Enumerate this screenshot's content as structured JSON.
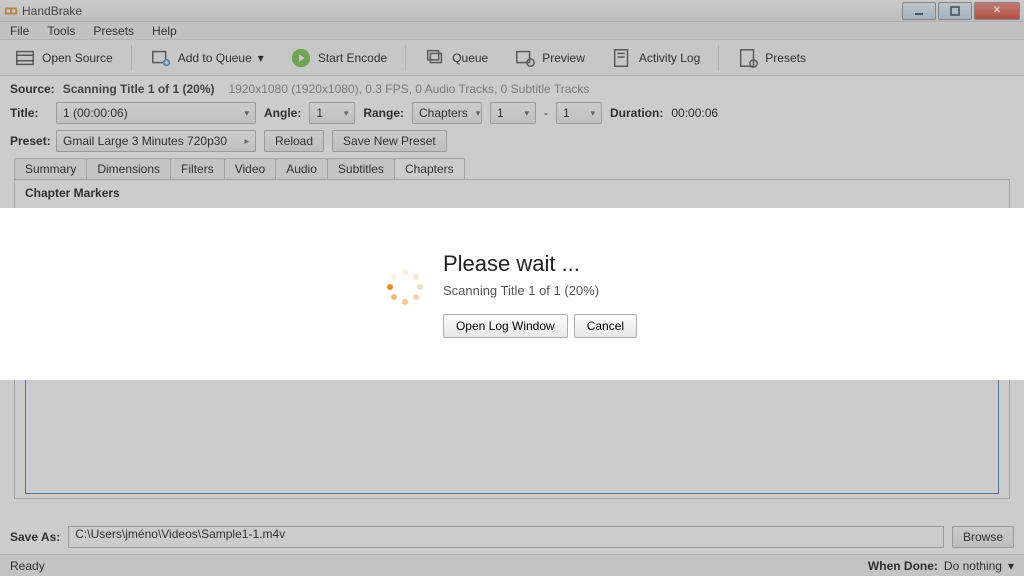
{
  "window": {
    "title": "HandBrake"
  },
  "menu": {
    "file": "File",
    "tools": "Tools",
    "presets": "Presets",
    "help": "Help"
  },
  "toolbar": {
    "open_source": "Open Source",
    "add_to_queue": "Add to Queue",
    "start_encode": "Start Encode",
    "queue": "Queue",
    "preview": "Preview",
    "activity_log": "Activity Log",
    "presets": "Presets"
  },
  "source": {
    "label": "Source:",
    "scan_text": "Scanning Title 1 of 1 (20%)",
    "info": "1920x1080 (1920x1080), 0.3 FPS, 0 Audio Tracks, 0 Subtitle Tracks"
  },
  "title_row": {
    "title_label": "Title:",
    "title_value": "1  (00:00:06)",
    "angle_label": "Angle:",
    "angle_value": "1",
    "range_label": "Range:",
    "range_mode": "Chapters",
    "range_from": "1",
    "range_dash": "-",
    "range_to": "1",
    "duration_label": "Duration:",
    "duration_value": "00:00:06"
  },
  "preset_row": {
    "label": "Preset:",
    "value": "Gmail Large 3 Minutes 720p30",
    "reload": "Reload",
    "save_new": "Save New Preset"
  },
  "tabs": {
    "summary": "Summary",
    "dimensions": "Dimensions",
    "filters": "Filters",
    "video": "Video",
    "audio": "Audio",
    "subtitles": "Subtitles",
    "chapters": "Chapters"
  },
  "chapters_pane": {
    "heading": "Chapter Markers"
  },
  "save": {
    "label": "Save As:",
    "path": "C:\\Users\\jméno\\Videos\\Sample1-1.m4v",
    "browse": "Browse"
  },
  "status": {
    "left": "Ready",
    "when_done_label": "When Done:",
    "when_done_value": "Do nothing"
  },
  "modal": {
    "heading": "Please wait ...",
    "subtext": "Scanning Title 1 of 1 (20%)",
    "open_log": "Open Log Window",
    "cancel": "Cancel"
  }
}
